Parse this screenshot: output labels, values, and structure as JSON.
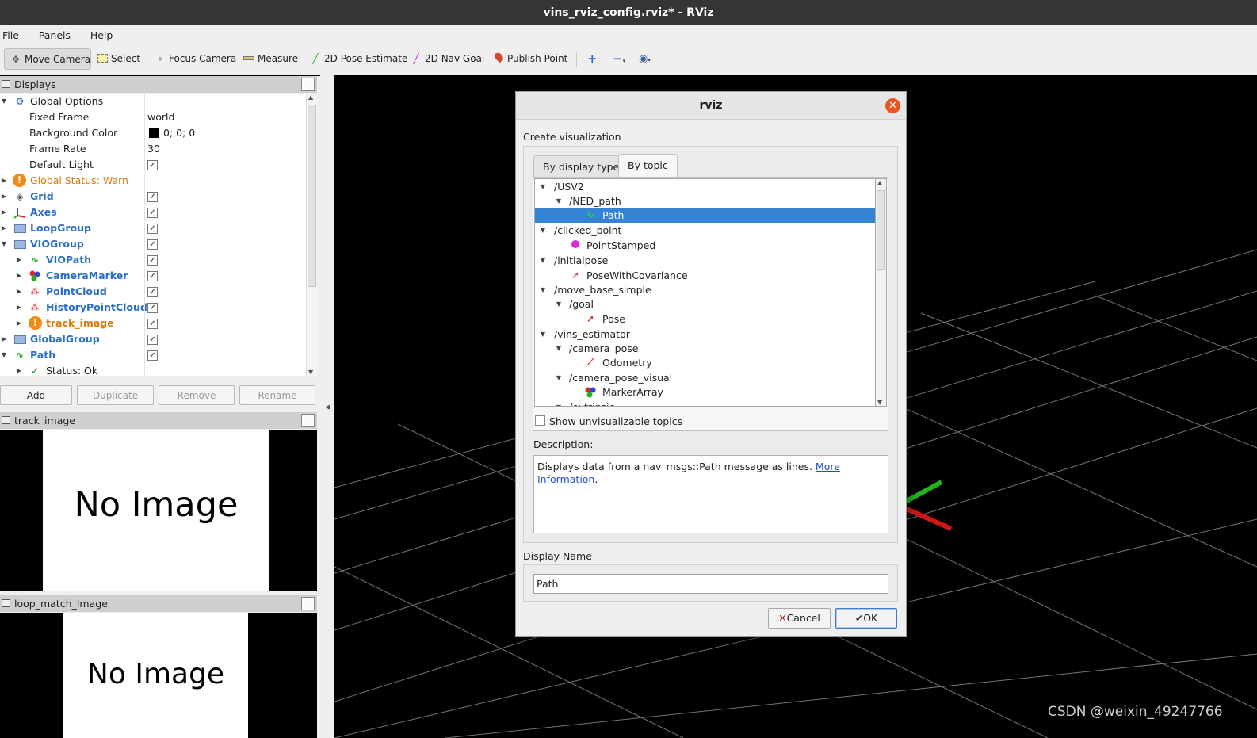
{
  "window": {
    "title": "vins_rviz_config.rviz* - RViz"
  },
  "menu": [
    "File",
    "Panels",
    "Help"
  ],
  "toolbar": {
    "tools": [
      {
        "label": "Move Camera",
        "icon": "move-camera-icon",
        "glyph": "✥"
      },
      {
        "label": "Select",
        "icon": "select-icon",
        "glyph": "▭"
      },
      {
        "label": "Focus Camera",
        "icon": "focus-camera-icon",
        "glyph": "⌖"
      },
      {
        "label": "Measure",
        "icon": "measure-icon",
        "glyph": "▬"
      },
      {
        "label": "2D Pose Estimate",
        "icon": "pose-estimate-icon",
        "glyph": "╱"
      },
      {
        "label": "2D Nav Goal",
        "icon": "nav-goal-icon",
        "glyph": "╱"
      },
      {
        "label": "Publish Point",
        "icon": "publish-point-icon",
        "glyph": "📍"
      }
    ],
    "extras": [
      "+",
      "−",
      "◉"
    ]
  },
  "displays": {
    "title": "Displays",
    "rows": [
      {
        "name": "Global Options",
        "value": ""
      },
      {
        "name": "Fixed Frame",
        "value": "world"
      },
      {
        "name": "Background Color",
        "value": "0; 0; 0"
      },
      {
        "name": "Frame Rate",
        "value": "30"
      },
      {
        "name": "Default Light",
        "value": ""
      },
      {
        "name": "Global Status: Warn",
        "value": ""
      },
      {
        "name": "Grid",
        "value": ""
      },
      {
        "name": "Axes",
        "value": ""
      },
      {
        "name": "LoopGroup",
        "value": ""
      },
      {
        "name": "VIOGroup",
        "value": ""
      },
      {
        "name": "VIOPath",
        "value": ""
      },
      {
        "name": "CameraMarker",
        "value": ""
      },
      {
        "name": "PointCloud",
        "value": ""
      },
      {
        "name": "HistoryPointCloud",
        "value": ""
      },
      {
        "name": "track_image",
        "value": ""
      },
      {
        "name": "GlobalGroup",
        "value": ""
      },
      {
        "name": "Path",
        "value": ""
      },
      {
        "name": "Status: Ok",
        "value": ""
      }
    ],
    "buttons": {
      "add": "Add",
      "duplicate": "Duplicate",
      "remove": "Remove",
      "rename": "Rename"
    }
  },
  "image_panels": [
    {
      "title": "track_image",
      "placeholder": "No Image"
    },
    {
      "title": "loop_match_Image",
      "placeholder": "No Image"
    }
  ],
  "dialog": {
    "title": "rviz",
    "section_label": "Create visualization",
    "tabs": [
      "By display type",
      "By topic"
    ],
    "selected_tab": "By topic",
    "topics": [
      "/USV2",
      "/NED_path",
      "Path",
      "/clicked_point",
      "PointStamped",
      "/initialpose",
      "PoseWithCovariance",
      "/move_base_simple",
      "/goal",
      "Pose",
      "/vins_estimator",
      "/camera_pose",
      "Odometry",
      "/camera_pose_visual",
      "MarkerArray",
      "/extrinsic"
    ],
    "selected_topic": "Path",
    "show_unvisualizable": "Show unvisualizable topics",
    "description_label": "Description:",
    "description_text": "Displays data from a nav_msgs::Path message as lines. ",
    "description_link": "More Information",
    "description_end": ".",
    "display_name_label": "Display Name",
    "display_name_value": "Path",
    "cancel": "Cancel",
    "ok": "OK"
  },
  "watermark": "CSDN @weixin_49247766",
  "colors": {
    "accent": "#3584d4",
    "close": "#e95420",
    "warn": "#d97c0a",
    "link": "#2a6fc7"
  }
}
